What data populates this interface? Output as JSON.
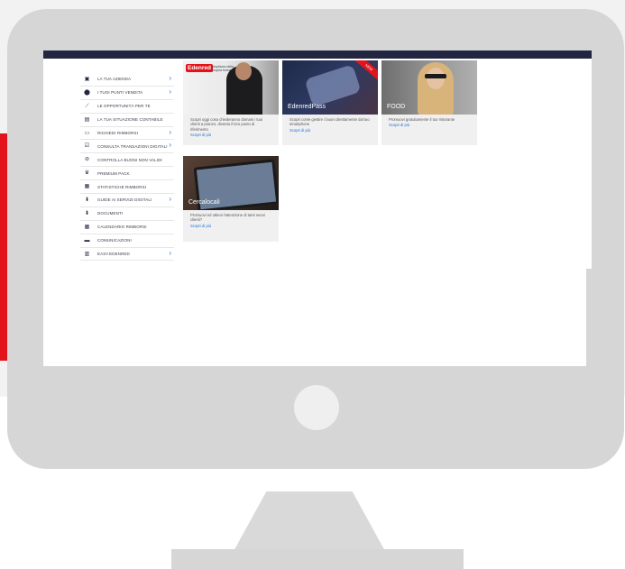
{
  "colors": {
    "brand_red": "#e3131b",
    "header_navy": "#232640",
    "link_blue": "#1e6fd9",
    "monitor_gray": "#d6d6d6"
  },
  "sidebar": {
    "items": [
      {
        "label": "LA TUA AZIENDA",
        "icon": "id-card-icon",
        "arrow": true
      },
      {
        "label": "I TUOI PUNTI VENDITA",
        "icon": "map-pin-icon",
        "arrow": true
      },
      {
        "label": "LE OPPORTUNITÀ PER TE",
        "icon": "trend-chart-icon",
        "arrow": false
      },
      {
        "label": "LA TUA SITUAZIONE CONTABILE",
        "icon": "document-icon",
        "arrow": false
      },
      {
        "label": "RICHIEDI RIMBORSI",
        "icon": "wallet-icon",
        "arrow": true
      },
      {
        "label": "CONSULTA TRANSAZIONI DIGITALI",
        "icon": "checkbox-icon",
        "arrow": true
      },
      {
        "label": "CONTROLLA BUONI NON VALIDI",
        "icon": "block-icon",
        "arrow": false
      },
      {
        "label": "PREMIUM PACK",
        "icon": "crown-icon",
        "arrow": false
      },
      {
        "label": "STATISTICHE RIMBORSI",
        "icon": "stats-card-icon",
        "arrow": false
      },
      {
        "label": "GUIDE AI SERVIZI DIGITALI",
        "icon": "download-icon",
        "arrow": true
      },
      {
        "label": "DOCUMENTI",
        "icon": "download-icon",
        "arrow": false
      },
      {
        "label": "CALENDARIO RIMBORSI",
        "icon": "calendar-icon",
        "arrow": false
      },
      {
        "label": "COMUNICAZIONI",
        "icon": "message-icon",
        "arrow": false
      },
      {
        "label": "EASY.EDENRED",
        "icon": "barcode-icon",
        "arrow": true
      }
    ]
  },
  "cards": [
    {
      "logo": "Edenred",
      "logo_tag": "Ampliamo della propria forma",
      "title": "",
      "text": "Scopri oggi cosa chiederanno domani i tuoi clienti a pranzo, diventa il loro punto di riferimento",
      "link": "Scopri di più"
    },
    {
      "logo": "",
      "logo_tag": "",
      "ribbon": "NEW",
      "title": "EdenredPass",
      "text": "Scopri come gestire i buoni direttamente dal tuo smartphone",
      "link": "Scopri di più"
    },
    {
      "logo": "",
      "logo_tag": "",
      "title": "FOOD",
      "text": "Promuovi gratuitamente il tuo ristorante",
      "link": "Scopri di più"
    },
    {
      "logo": "",
      "logo_tag": "",
      "title": "Cercalocali",
      "text": "Promuovi ed ottieni l'attenzione di tanti nuovi clienti?",
      "link": "Scopri di più"
    }
  ]
}
